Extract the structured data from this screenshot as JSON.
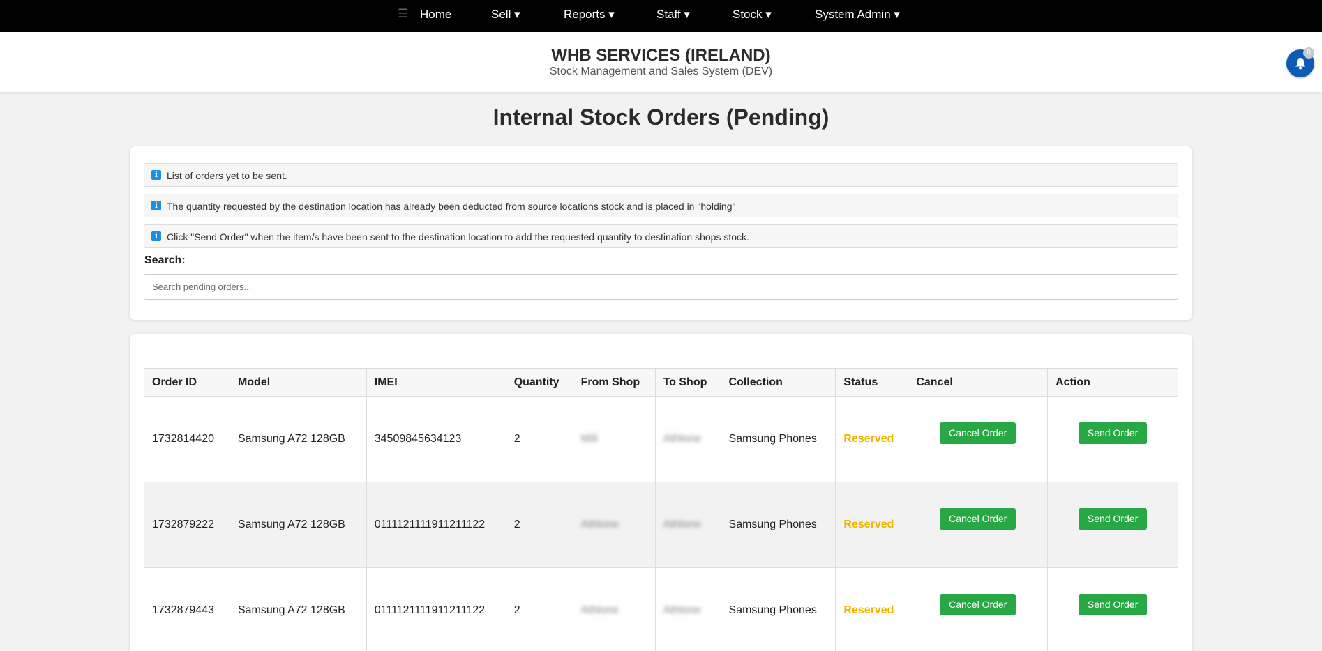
{
  "nav": {
    "menu_icon": "hamburger-icon",
    "items": [
      {
        "label": "Home"
      },
      {
        "label": "Sell ▾"
      },
      {
        "label": "Reports ▾"
      },
      {
        "label": "Staff ▾"
      },
      {
        "label": "Stock ▾"
      },
      {
        "label": "System Admin ▾"
      }
    ]
  },
  "header": {
    "company": "WHB SERVICES (IRELAND)",
    "subtitle": "Stock Management and Sales System (DEV)",
    "notification_count": "0"
  },
  "page_title": "Internal Stock Orders (Pending)",
  "info_messages": [
    "List of orders yet to be sent.",
    "The quantity requested by the destination location has already been deducted from source locations stock and is placed in \"holding\"",
    "Click \"Send Order\" when the item/s have been sent to the destination location to add the requested quantity to destination shops stock."
  ],
  "search": {
    "label": "Search:",
    "placeholder": "Search pending orders..."
  },
  "table": {
    "headers": [
      "Order ID",
      "Model",
      "IMEI",
      "Quantity",
      "From Shop",
      "To Shop",
      "Collection",
      "Status",
      "Cancel",
      "Action"
    ],
    "rows": [
      {
        "order_id": "1732814420",
        "model": "Samsung A72 128GB",
        "imei": "34509845634123",
        "quantity": "2",
        "from_shop": "Mill",
        "to_shop": "Athlone",
        "collection": "Samsung Phones",
        "status": "Reserved",
        "cancel_label": "Cancel Order",
        "action_label": "Send Order"
      },
      {
        "order_id": "1732879222",
        "model": "Samsung A72 128GB",
        "imei": "0111121111911211122",
        "quantity": "2",
        "from_shop": "Athlone",
        "to_shop": "Athlone",
        "collection": "Samsung Phones",
        "status": "Reserved",
        "cancel_label": "Cancel Order",
        "action_label": "Send Order"
      },
      {
        "order_id": "1732879443",
        "model": "Samsung A72 128GB",
        "imei": "0111121111911211122",
        "quantity": "2",
        "from_shop": "Athlone",
        "to_shop": "Athlone",
        "collection": "Samsung Phones",
        "status": "Reserved",
        "cancel_label": "Cancel Order",
        "action_label": "Send Order"
      }
    ]
  },
  "colors": {
    "nav_bg": "#000000",
    "button_green": "#28a745",
    "status_reserved": "#f0b400",
    "bell_blue": "#0d5bb5",
    "info_icon": "#1a8fe3"
  }
}
